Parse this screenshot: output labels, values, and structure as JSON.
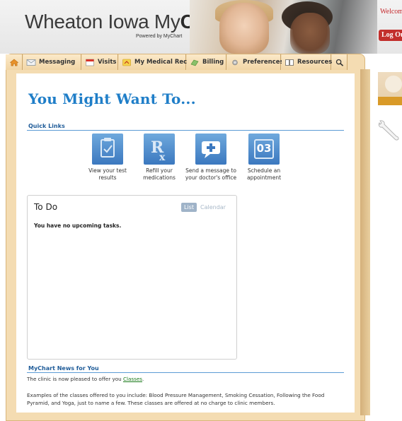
{
  "header": {
    "brand_name": "Wheaton Iowa My",
    "brand_bold": "Care",
    "brand_sub": "Powered by MyChart",
    "welcome": "Welcome",
    "logout": "Log Out"
  },
  "tabs": [
    {
      "label": "",
      "icon": "home-icon"
    },
    {
      "label": "Messaging",
      "icon": "envelope-icon"
    },
    {
      "label": "Visits",
      "icon": "calendar-icon"
    },
    {
      "label": "My Medical Record",
      "icon": "medical-record-icon"
    },
    {
      "label": "Billing",
      "icon": "billing-icon"
    },
    {
      "label": "Preferences",
      "icon": "gear-icon"
    },
    {
      "label": "Resources",
      "icon": "book-icon"
    },
    {
      "label": "",
      "icon": "search-icon"
    }
  ],
  "main": {
    "title": "You Might Want To...",
    "quick_links_heading": "Quick Links",
    "quick_links": [
      {
        "line1": "View your test",
        "line2": "results",
        "icon": "clipboard-icon"
      },
      {
        "line1": "Refill your",
        "line2": "medications",
        "icon": "rx-icon"
      },
      {
        "line1": "Send a message to",
        "line2": "your doctor's office",
        "icon": "message-plus-icon"
      },
      {
        "line1": "Schedule an",
        "line2": "appointment",
        "icon": "calendar-03-icon",
        "badge": "03"
      }
    ]
  },
  "todo": {
    "title": "To Do",
    "list_label": "List",
    "calendar_label": "Calendar",
    "empty_message": "You have no upcoming tasks."
  },
  "news": {
    "heading": "MyChart News for You",
    "line1_before": "The clinic is now pleased to offer you ",
    "line1_link": "Classes",
    "line1_after": ".",
    "para2_line1": "Examples of the classes offered to you include: Blood Pressure Management, Smoking Cessation, Following the Food",
    "para2_line2": "Pyramid, and Yoga, just to name a few.  These classes are offered at no charge to clinic members."
  },
  "colors": {
    "accent_blue": "#1f7ec8",
    "logout_red": "#c22f2c",
    "frame_tan": "#f4dcb2",
    "link_green": "#1a7a1a"
  }
}
